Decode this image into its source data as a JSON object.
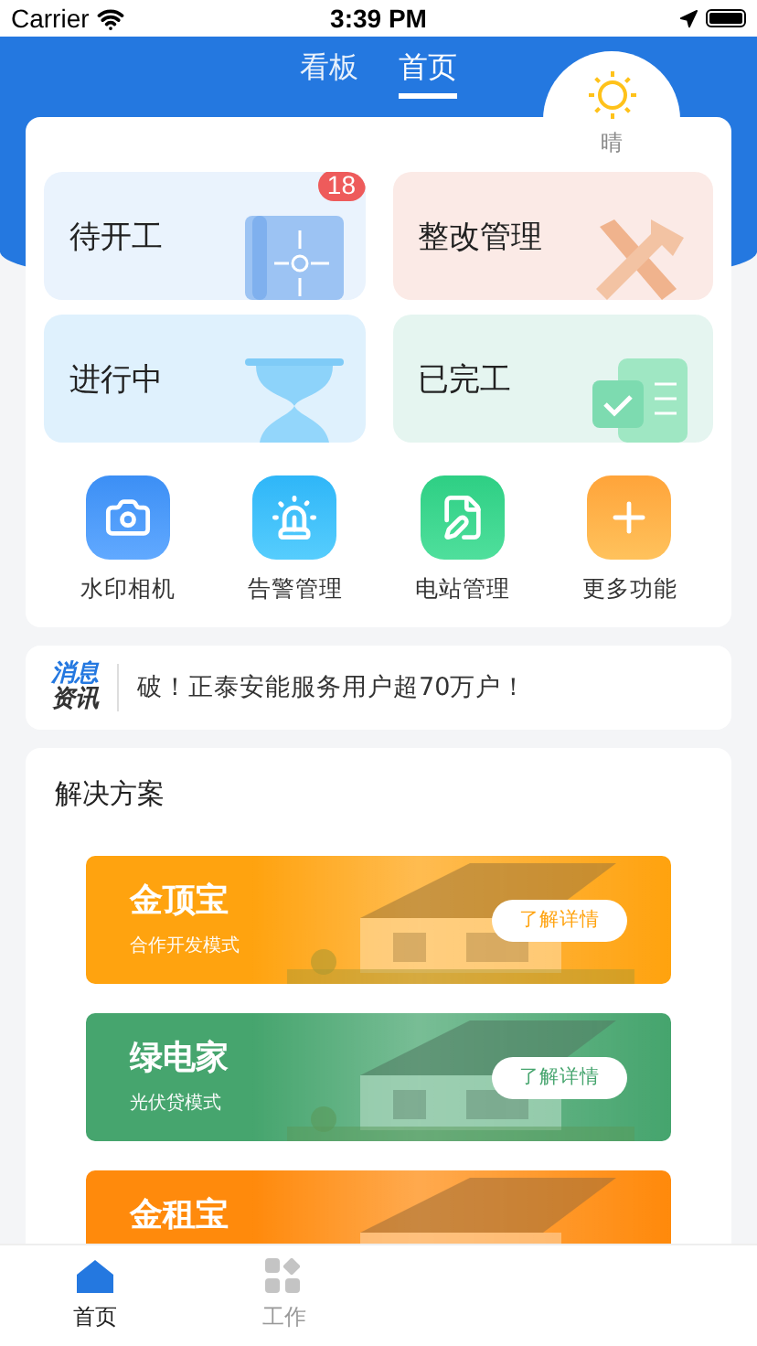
{
  "status_bar": {
    "carrier": "Carrier",
    "time": "3:39 PM"
  },
  "top_tabs": [
    {
      "label": "看板",
      "selected": false
    },
    {
      "label": "首页",
      "selected": true
    }
  ],
  "weather": {
    "label": "晴"
  },
  "tiles": [
    {
      "label": "待开工",
      "badge": "18",
      "kind": "blueprint"
    },
    {
      "label": "整改管理",
      "kind": "tools"
    },
    {
      "label": "进行中",
      "kind": "hourglass"
    },
    {
      "label": "已完工",
      "kind": "done"
    }
  ],
  "shortcuts": [
    {
      "label": "水印相机",
      "kind": "camera"
    },
    {
      "label": "告警管理",
      "kind": "alarm"
    },
    {
      "label": "电站管理",
      "kind": "station"
    },
    {
      "label": "更多功能",
      "kind": "more"
    }
  ],
  "news": {
    "tag_top": "消息",
    "tag_bottom": "资讯",
    "text": "破！正泰安能服务用户超70万户！"
  },
  "solutions": {
    "title": "解决方案",
    "banners": [
      {
        "title": "金顶宝",
        "subtitle": "合作开发模式",
        "button": "了解详情",
        "color": "#ffa30f"
      },
      {
        "title": "绿电家",
        "subtitle": "光伏贷模式",
        "button": "了解详情",
        "color": "#46a56e"
      },
      {
        "title": "金租宝",
        "color": "#ff8a0c"
      }
    ]
  },
  "tab_bar": [
    {
      "label": "首页",
      "kind": "home",
      "selected": true
    },
    {
      "label": "工作",
      "kind": "grid",
      "selected": false
    }
  ]
}
